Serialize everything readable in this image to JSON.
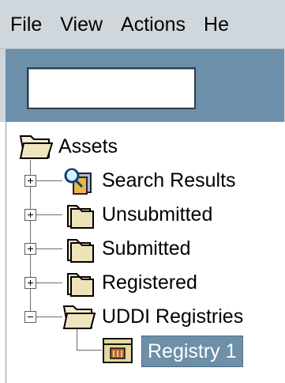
{
  "menubar": {
    "items": [
      {
        "label": "File"
      },
      {
        "label": "View"
      },
      {
        "label": "Actions"
      },
      {
        "label": "He"
      }
    ]
  },
  "search": {
    "value": "",
    "placeholder": ""
  },
  "tree": {
    "root": {
      "label": "Assets",
      "icon": "folder-open-icon"
    },
    "items": [
      {
        "label": "Search Results",
        "icon": "search-results-icon",
        "expanded": false
      },
      {
        "label": "Unsubmitted",
        "icon": "folder-icon",
        "expanded": false
      },
      {
        "label": "Submitted",
        "icon": "folder-icon",
        "expanded": false
      },
      {
        "label": "Registered",
        "icon": "folder-icon",
        "expanded": false
      },
      {
        "label": "UDDI Registries",
        "icon": "folder-open-icon",
        "expanded": true
      }
    ],
    "child": {
      "label": "Registry 1",
      "icon": "registry-icon",
      "selected": true
    }
  },
  "colors": {
    "menubar_bg": "#d0d7dc",
    "toolbar_bg": "#6d90aa",
    "selection_bg": "#6e8fa8",
    "folder_fill": "#f2e8c7"
  }
}
